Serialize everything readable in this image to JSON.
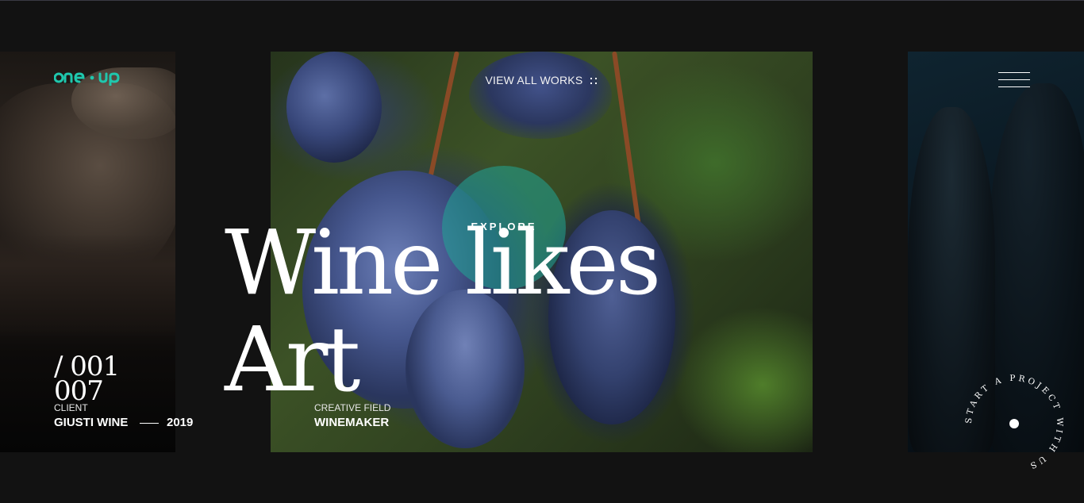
{
  "brand": {
    "logo_text": "one·up",
    "accent": "#1fc7ad"
  },
  "nav": {
    "view_all_label": "VIEW ALL WORKS",
    "view_all_icon": "grid-dots-icon",
    "menu_icon": "hamburger-menu-icon"
  },
  "hero": {
    "explore_label": "EXPLORE",
    "headline_line1": "Wine likes",
    "headline_line2": "Art",
    "field_label": "CREATIVE FIELD",
    "field_value": "WINEMAKER"
  },
  "project": {
    "counter_current": "/ 001",
    "counter_total": "007",
    "client_label": "CLIENT",
    "client_name": "GIUSTI WINE",
    "year": "2019"
  },
  "badge": {
    "text": "START A PROJECT WITH US"
  },
  "colors": {
    "background": "#121212",
    "explore_circle": "#21a596",
    "text": "#ffffff"
  }
}
